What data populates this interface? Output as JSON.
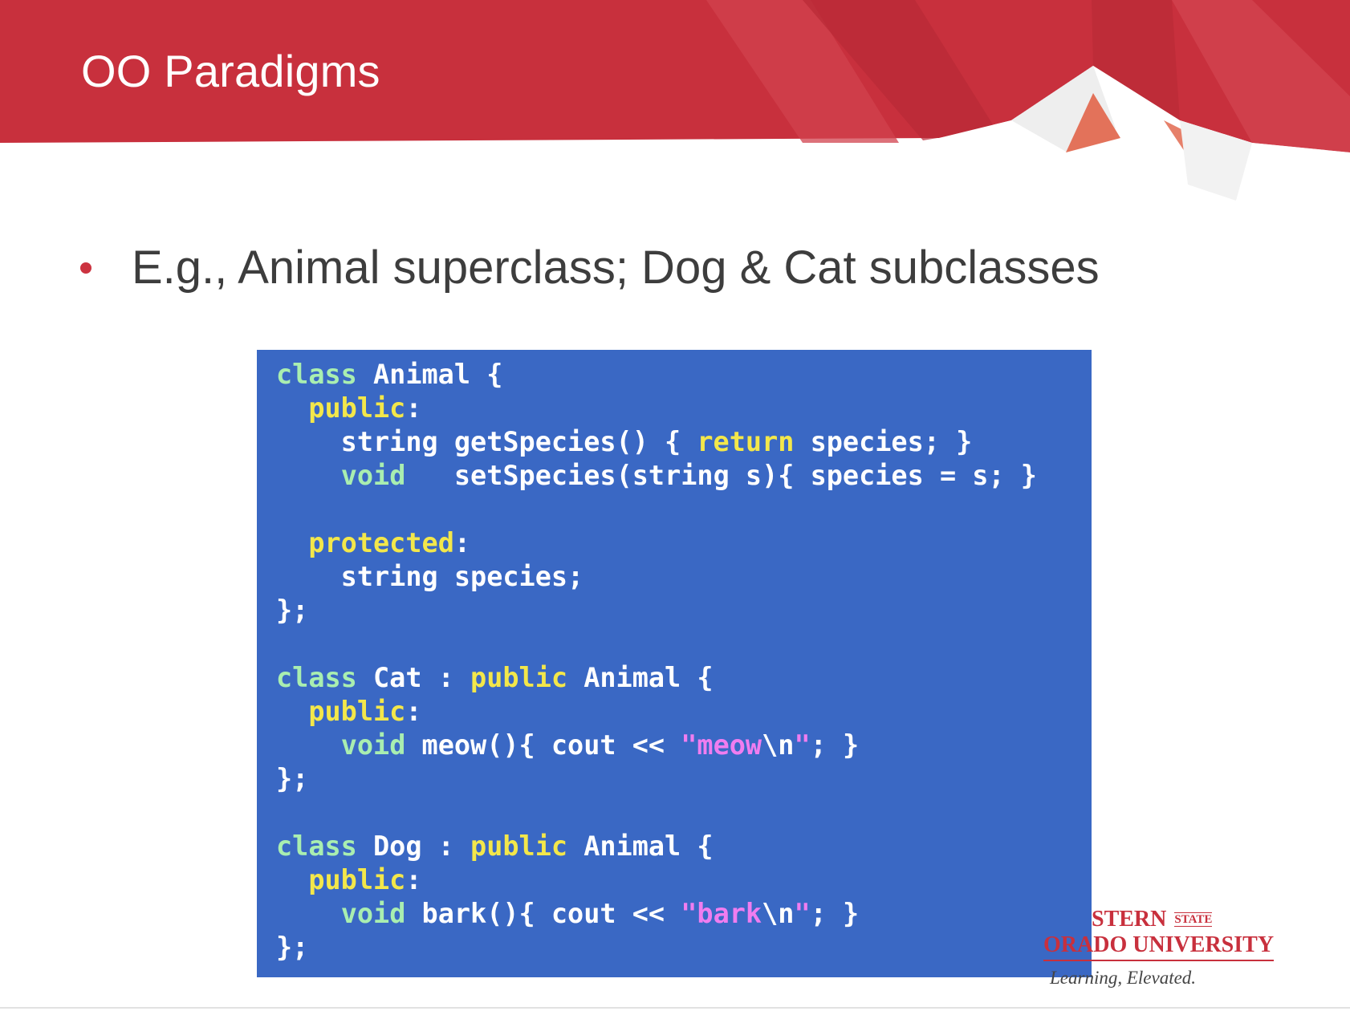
{
  "slide": {
    "title": "OO Paradigms",
    "bullet": "E.g., Animal superclass; Dog & Cat subclasses"
  },
  "colors": {
    "header_red": "#c8303d",
    "code_bg": "#3a68c4",
    "keyword": "#a9eeb0",
    "modifier": "#f3e74a",
    "string": "#f07df0"
  },
  "code": {
    "lines": [
      [
        {
          "t": "class",
          "c": "kw"
        },
        {
          "t": " Animal {",
          "c": "plain"
        }
      ],
      [
        {
          "t": "  ",
          "c": "plain"
        },
        {
          "t": "public",
          "c": "mod"
        },
        {
          "t": ":",
          "c": "plain"
        }
      ],
      [
        {
          "t": "    string getSpecies() { ",
          "c": "plain"
        },
        {
          "t": "return",
          "c": "mod"
        },
        {
          "t": " species; }",
          "c": "plain"
        }
      ],
      [
        {
          "t": "    ",
          "c": "plain"
        },
        {
          "t": "void",
          "c": "kw"
        },
        {
          "t": "   setSpecies(string s){ species = s; }",
          "c": "plain"
        }
      ],
      [],
      [
        {
          "t": "  ",
          "c": "plain"
        },
        {
          "t": "protected",
          "c": "mod"
        },
        {
          "t": ":",
          "c": "plain"
        }
      ],
      [
        {
          "t": "    string species;",
          "c": "plain"
        }
      ],
      [
        {
          "t": "};",
          "c": "plain"
        }
      ],
      [],
      [
        {
          "t": "class",
          "c": "kw"
        },
        {
          "t": " Cat : ",
          "c": "plain"
        },
        {
          "t": "public",
          "c": "mod"
        },
        {
          "t": " Animal {",
          "c": "plain"
        }
      ],
      [
        {
          "t": "  ",
          "c": "plain"
        },
        {
          "t": "public",
          "c": "mod"
        },
        {
          "t": ":",
          "c": "plain"
        }
      ],
      [
        {
          "t": "    ",
          "c": "plain"
        },
        {
          "t": "void",
          "c": "kw"
        },
        {
          "t": " meow(){ cout << ",
          "c": "plain"
        },
        {
          "t": "\"meow",
          "c": "str"
        },
        {
          "t": "\\n",
          "c": "plain"
        },
        {
          "t": "\"",
          "c": "str"
        },
        {
          "t": "; }",
          "c": "plain"
        }
      ],
      [
        {
          "t": "};",
          "c": "plain"
        }
      ],
      [],
      [
        {
          "t": "class",
          "c": "kw"
        },
        {
          "t": " Dog : ",
          "c": "plain"
        },
        {
          "t": "public",
          "c": "mod"
        },
        {
          "t": " Animal {",
          "c": "plain"
        }
      ],
      [
        {
          "t": "  ",
          "c": "plain"
        },
        {
          "t": "public",
          "c": "mod"
        },
        {
          "t": ":",
          "c": "plain"
        }
      ],
      [
        {
          "t": "    ",
          "c": "plain"
        },
        {
          "t": "void",
          "c": "kw"
        },
        {
          "t": " bark(){ cout << ",
          "c": "plain"
        },
        {
          "t": "\"bark",
          "c": "str"
        },
        {
          "t": "\\n",
          "c": "plain"
        },
        {
          "t": "\"",
          "c": "str"
        },
        {
          "t": "; }",
          "c": "plain"
        }
      ],
      [
        {
          "t": "};",
          "c": "plain"
        }
      ]
    ]
  },
  "logo": {
    "line1": "STERN",
    "state": "STATE",
    "line2": "ORADO UNIVERSITY",
    "tagline": "Learning, Elevated."
  }
}
